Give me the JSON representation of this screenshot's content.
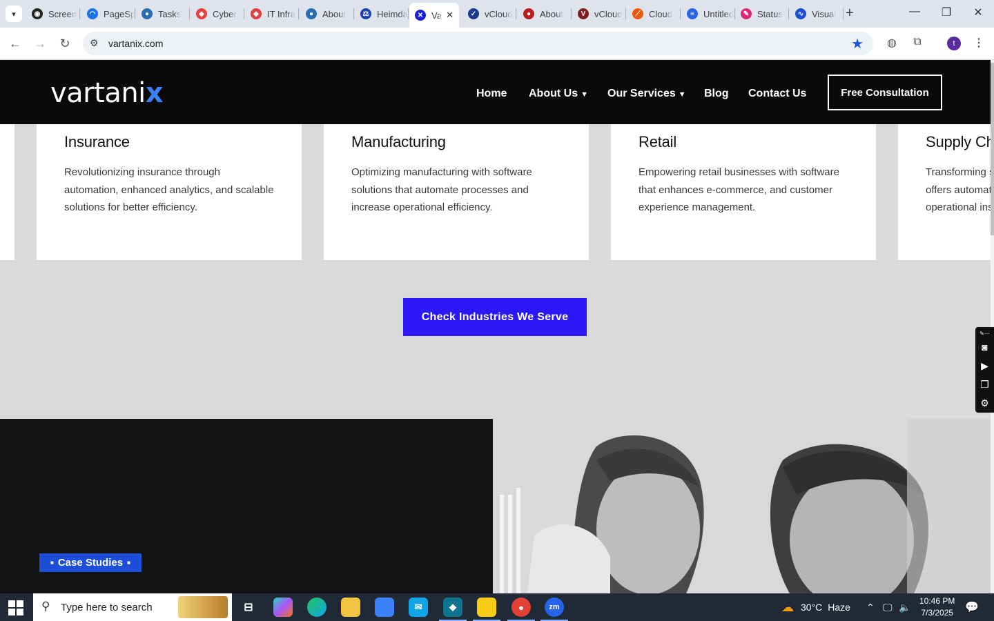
{
  "browser": {
    "tabs": [
      {
        "title": "Screen",
        "color": "#222222",
        "glyph": "◉"
      },
      {
        "title": "PageSpeed",
        "color": "#1a73e8",
        "glyph": "◠"
      },
      {
        "title": "Tasks",
        "color": "#2b6cb0",
        "glyph": "●"
      },
      {
        "title": "Cyber",
        "color": "#e53e3e",
        "glyph": "◆"
      },
      {
        "title": "IT Infra",
        "color": "#e53e3e",
        "glyph": "◆"
      },
      {
        "title": "About",
        "color": "#2b6cb0",
        "glyph": "●"
      },
      {
        "title": "Heimdal",
        "color": "#1e40af",
        "glyph": "⚖"
      },
      {
        "title": "Va",
        "color": "#1d1dd9",
        "glyph": "✕",
        "active": true
      },
      {
        "title": "vCloud",
        "color": "#1e3a8a",
        "glyph": "✓"
      },
      {
        "title": "About",
        "color": "#b91c1c",
        "glyph": "●"
      },
      {
        "title": "vCloud",
        "color": "#7f1d1d",
        "glyph": "V"
      },
      {
        "title": "Cloud",
        "color": "#ea580c",
        "glyph": "⟋"
      },
      {
        "title": "Untitled",
        "color": "#2563eb",
        "glyph": "≡"
      },
      {
        "title": "Status",
        "color": "#db2777",
        "glyph": "✎"
      },
      {
        "title": "Visual",
        "color": "#1d4ed8",
        "glyph": "∿"
      }
    ],
    "url": "vartanix.com",
    "profile_initial": "t"
  },
  "site": {
    "logo_text": "vartani",
    "logo_accent": "x",
    "nav": {
      "home": "Home",
      "about": "About Us",
      "services": "Our Services",
      "blog": "Blog",
      "contact": "Contact Us"
    },
    "cta_label": "Free Consultation"
  },
  "industries": {
    "cards": [
      {
        "title": "Insurance",
        "desc": "Revolutionizing insurance through automation, enhanced analytics, and scalable solutions for better efficiency."
      },
      {
        "title": "Manufacturing",
        "desc": "Optimizing manufacturing with software solutions that automate processes and increase operational efficiency."
      },
      {
        "title": "Retail",
        "desc": "Empowering retail businesses with software that enhances e-commerce, and customer experience management."
      },
      {
        "title": "Supply Chain",
        "desc": "Transforming supply chains with software that offers automated inventory tracking and operational insights."
      }
    ],
    "button_label": "Check Industries We Serve"
  },
  "case_studies": {
    "badge": "Case Studies"
  },
  "taskbar": {
    "search_placeholder": "Type here to search",
    "weather_temp": "30°C",
    "weather_desc": "Haze",
    "time": "10:46 PM",
    "date": "7/3/2025"
  },
  "colors": {
    "brand_blue": "#2b18f5",
    "badge_blue": "#1d4ed8",
    "header_bg": "#0a0a0a"
  }
}
